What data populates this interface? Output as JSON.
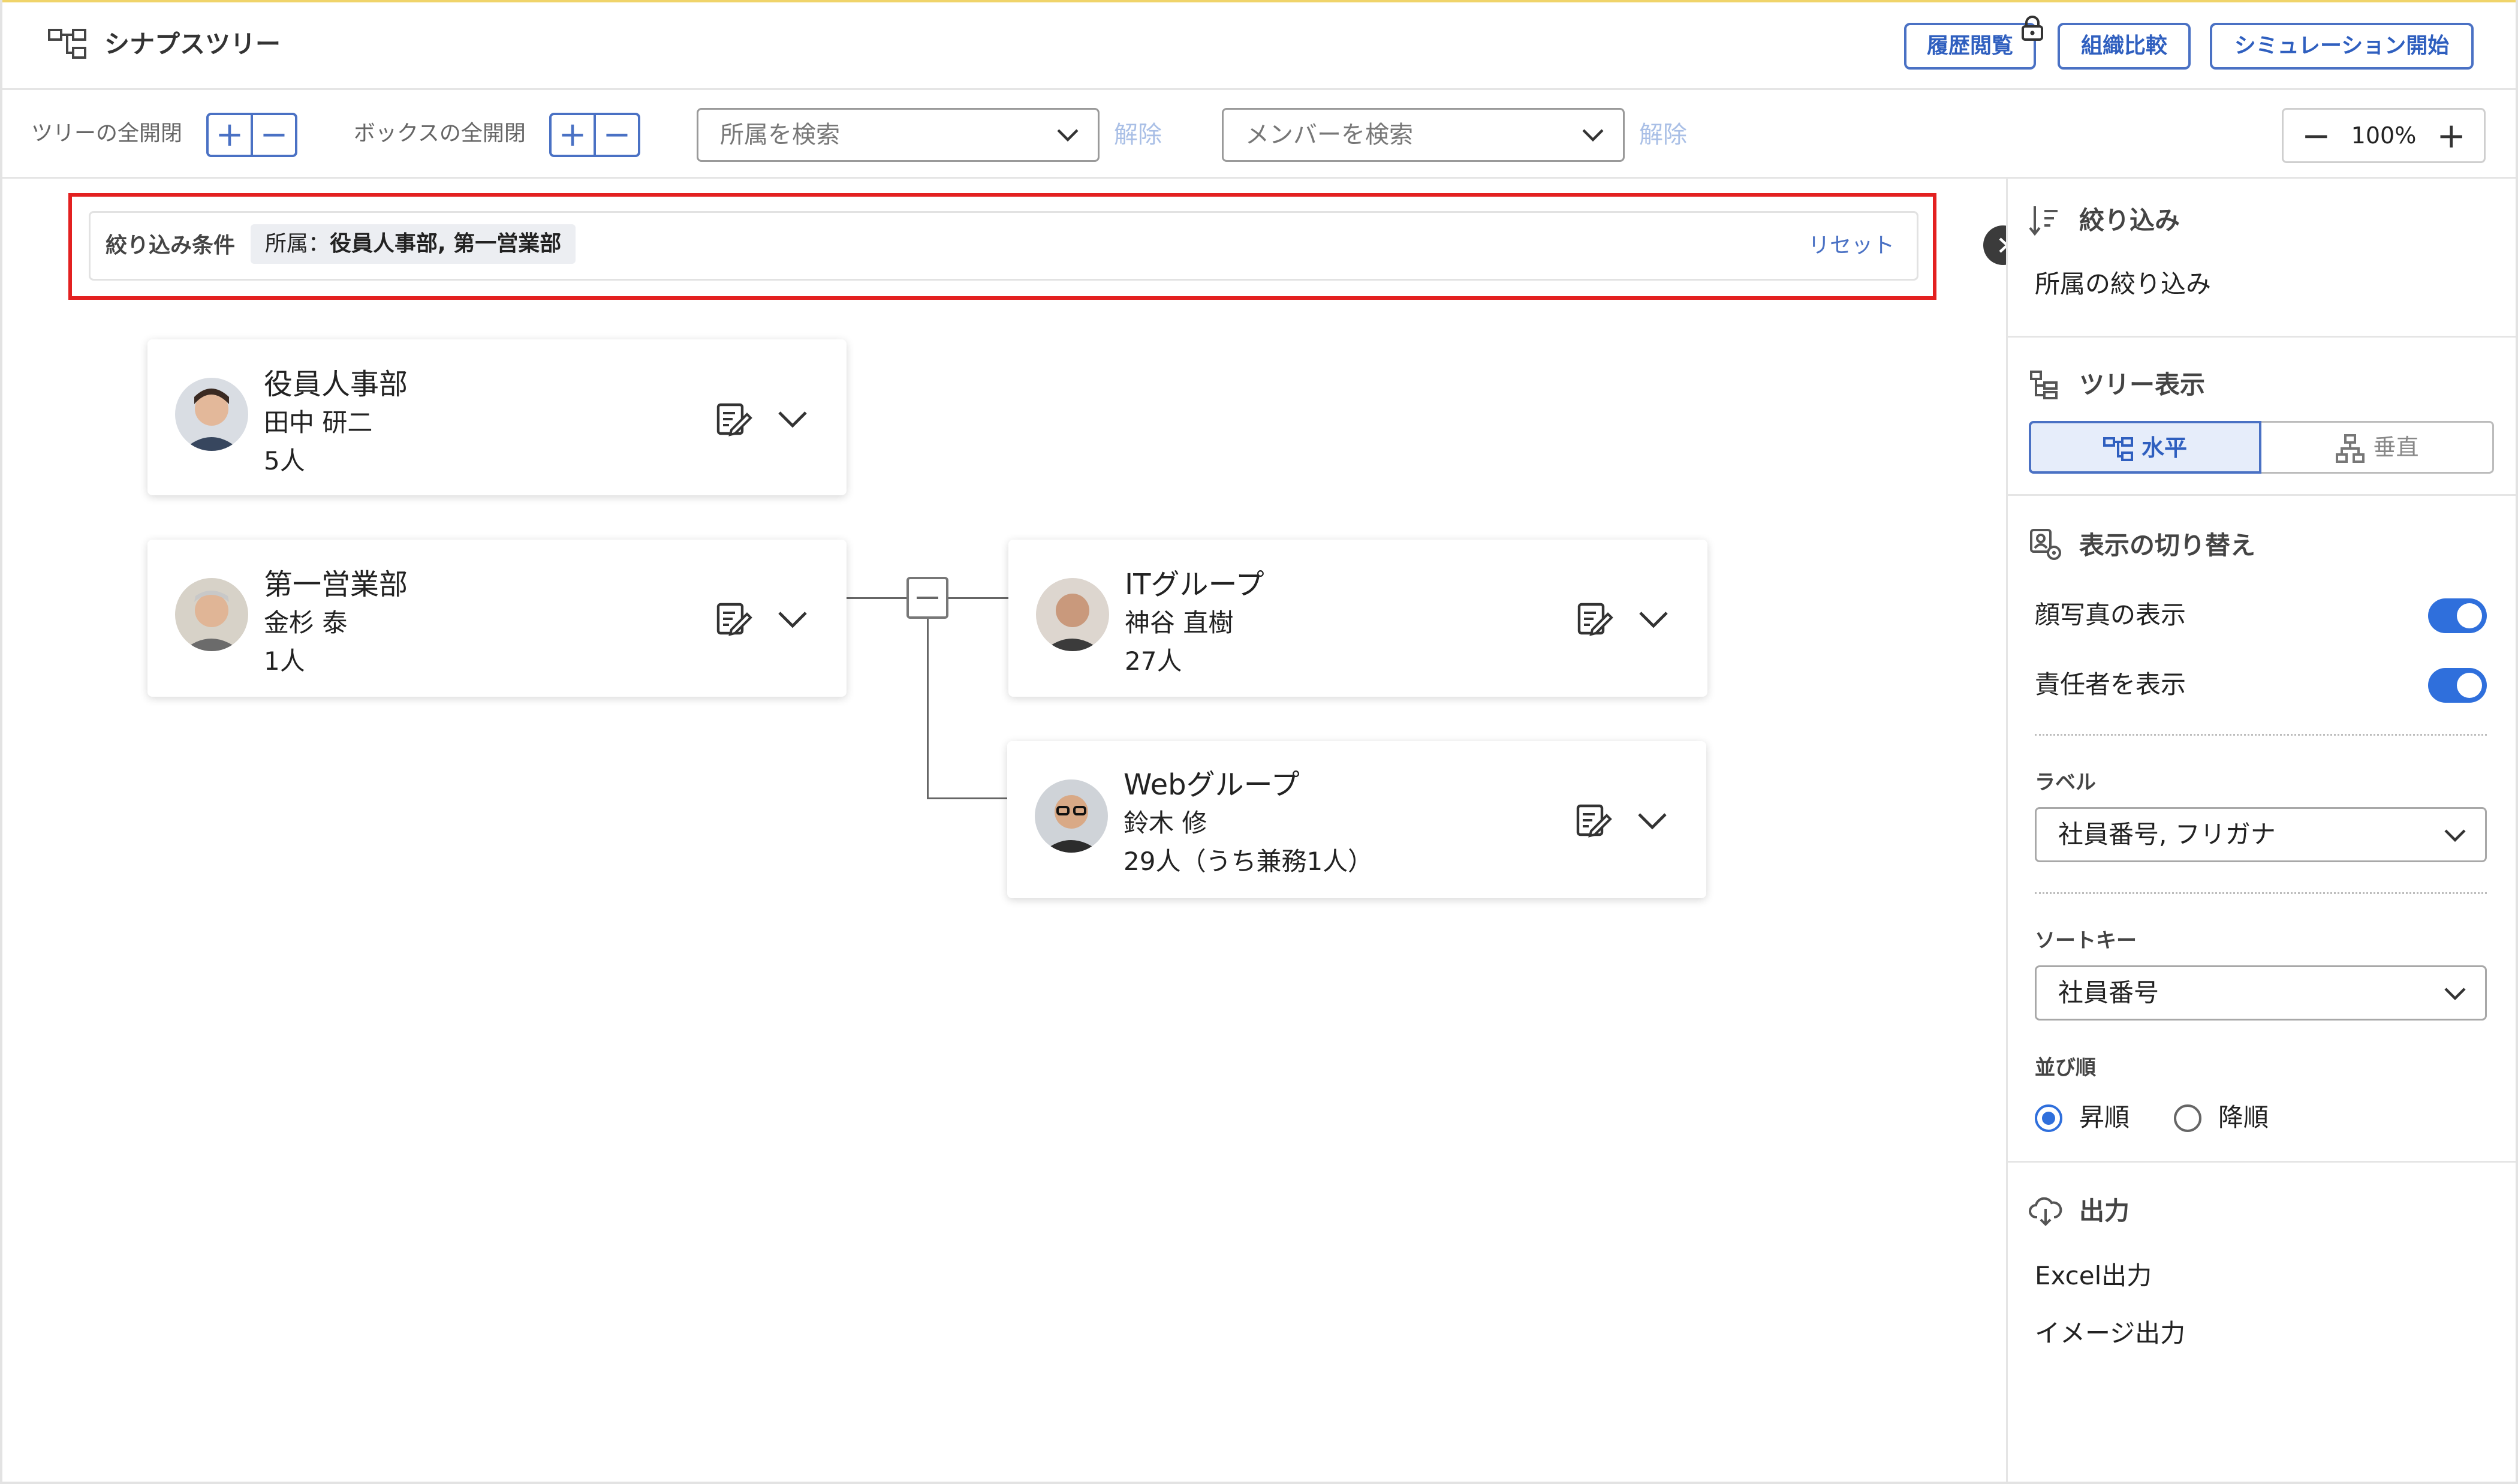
{
  "app": {
    "title": "シナプスツリー",
    "buttons": {
      "history": "履歴閲覧",
      "compare": "組織比較",
      "simulation": "シミュレーション開始"
    }
  },
  "toolbar": {
    "tree_toggle_label": "ツリーの全開閉",
    "box_toggle_label": "ボックスの全開閉",
    "affiliation_search_placeholder": "所属を検索",
    "member_search_placeholder": "メンバーを検索",
    "clear_label": "解除",
    "zoom_level": "100%"
  },
  "filter_bar": {
    "label": "絞り込み条件",
    "chip_key": "所属：",
    "chip_value": "役員人事部, 第一営業部",
    "reset": "リセット"
  },
  "cards": [
    {
      "name": "役員人事部",
      "manager": "田中 研二",
      "count": "5人"
    },
    {
      "name": "第一営業部",
      "manager": "金杉 泰",
      "count": "1人"
    },
    {
      "name": "ITグループ",
      "manager": "神谷 直樹",
      "count": "27人"
    },
    {
      "name": "Webグループ",
      "manager": "鈴木 修",
      "count": "29人（うち兼務1人）"
    }
  ],
  "panel": {
    "filter_title": "絞り込み",
    "filter_item": "所属の絞り込み",
    "tree_title": "ツリー表示",
    "tree_horizontal": "水平",
    "tree_vertical": "垂直",
    "display_title": "表示の切り替え",
    "show_photo": "顔写真の表示",
    "show_manager": "責任者を表示",
    "label_title": "ラベル",
    "label_value": "社員番号, フリガナ",
    "sortkey_title": "ソートキー",
    "sortkey_value": "社員番号",
    "order_title": "並び順",
    "order_asc": "昇順",
    "order_desc": "降順",
    "output_title": "出力",
    "excel_output": "Excel出力",
    "image_output": "イメージ出力"
  },
  "colors": {
    "accent": "#2f6fdc",
    "highlight": "#e32020",
    "button_border": "#4a71c4"
  }
}
